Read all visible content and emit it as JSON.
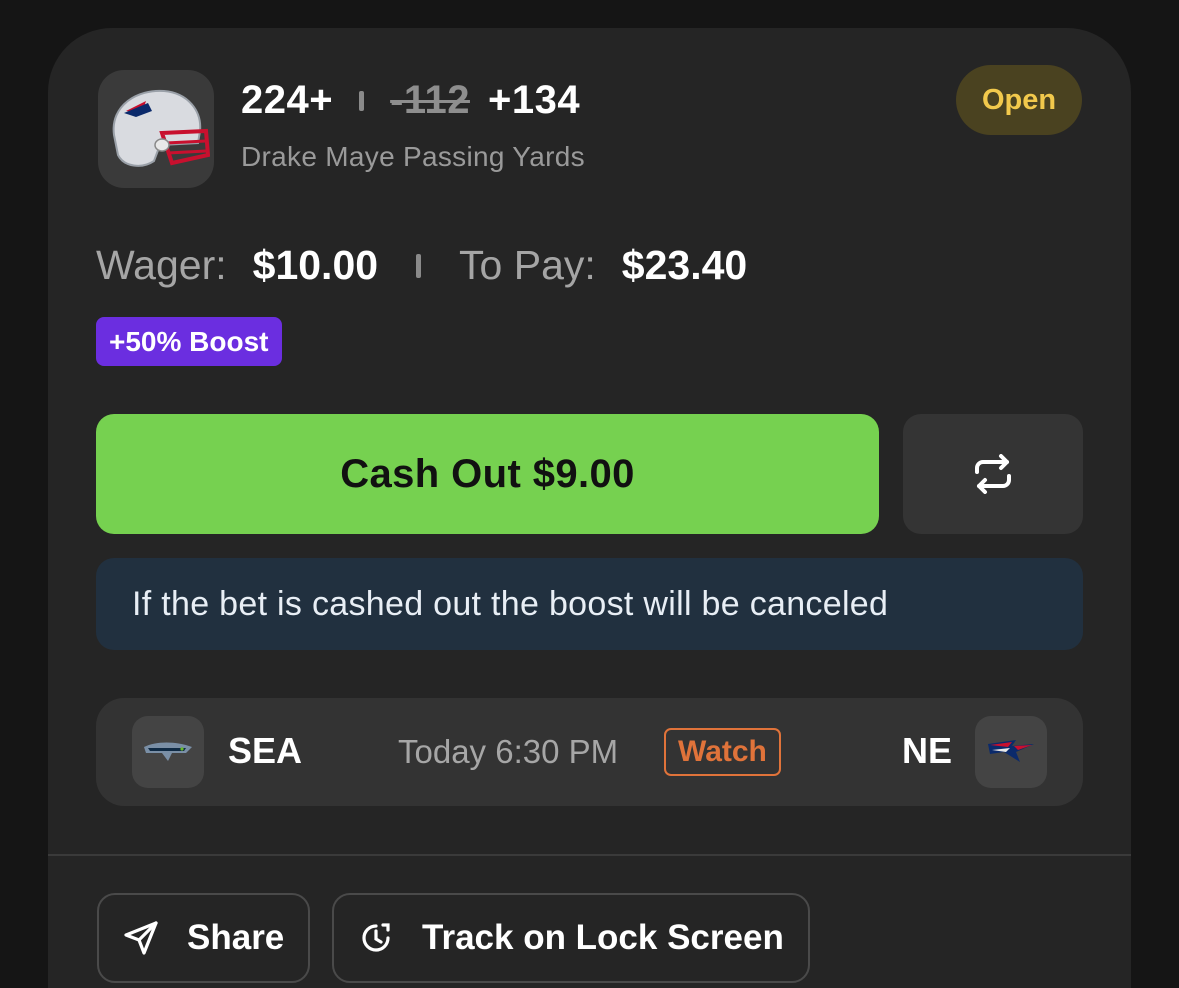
{
  "bet": {
    "line": "224+",
    "old_odds": "-112",
    "new_odds": "+134",
    "prop": "Drake Maye Passing Yards",
    "status": "Open"
  },
  "stake": {
    "wager_label": "Wager:",
    "wager_value": "$10.00",
    "pay_label": "To Pay:",
    "pay_value": "$23.40",
    "boost": "+50% Boost"
  },
  "actions": {
    "cashout_label": "Cash Out $9.00",
    "swap_icon": "swap-arrows-icon",
    "notice": "If the bet is cashed out the boost will be canceled"
  },
  "game": {
    "away": "SEA",
    "time": "Today 6:30 PM",
    "watch": "Watch",
    "home": "NE"
  },
  "footer": {
    "share": "Share",
    "track": "Track on Lock Screen"
  },
  "colors": {
    "card": "#252525",
    "cashout": "#76d150",
    "boost": "#6b2ee0",
    "status": "#f2c94c",
    "watch": "#e0733a",
    "notice": "#21303f"
  }
}
